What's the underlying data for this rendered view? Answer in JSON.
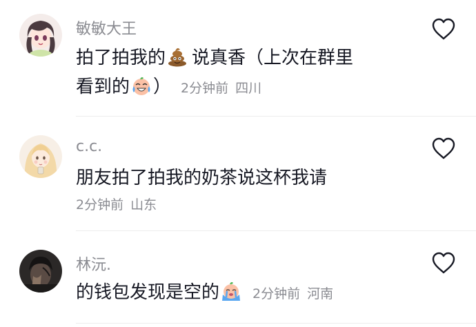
{
  "comments": [
    {
      "username": "敏敏大王",
      "line1_text": "拍了拍我的",
      "line1_emoji": "poop-emoji",
      "line1_after": "说真香（上次在群里",
      "line2_text": "看到的",
      "line2_emoji": "laughing-crying-emoji",
      "line2_after": "）",
      "time": "2分钟前",
      "location": "四川"
    },
    {
      "username": "c.c.",
      "line1_text": "朋友拍了拍我的奶茶说这杯我请",
      "time": "2分钟前",
      "location": "山东"
    },
    {
      "username": "林沅.",
      "line1_text": "的钱包发现是空的",
      "line1_emoji": "crying-emoji",
      "time": "2分钟前",
      "location": "河南"
    }
  ],
  "icons": {
    "like": "heart-outline-icon"
  },
  "colors": {
    "text": "#161823",
    "secondary": "#8a8b91",
    "divider": "#ececec"
  }
}
